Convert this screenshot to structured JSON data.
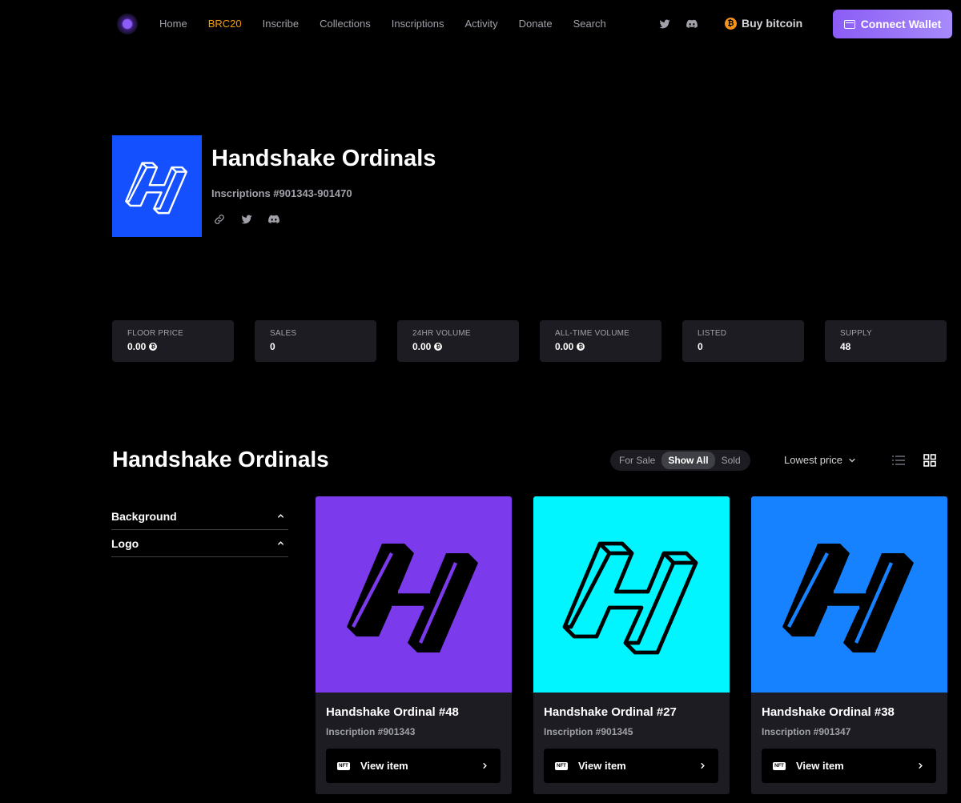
{
  "nav": {
    "links": [
      {
        "label": "Home",
        "active": false
      },
      {
        "label": "BRC20",
        "active": true
      },
      {
        "label": "Inscribe",
        "active": false
      },
      {
        "label": "Collections",
        "active": false
      },
      {
        "label": "Inscriptions",
        "active": false
      },
      {
        "label": "Activity",
        "active": false
      },
      {
        "label": "Donate",
        "active": false
      },
      {
        "label": "Search",
        "active": false
      }
    ],
    "social": [
      "twitter-icon",
      "discord-icon"
    ],
    "buy_bitcoin": "Buy bitcoin",
    "connect_wallet": "Connect Wallet"
  },
  "collection": {
    "title": "Handshake Ordinals",
    "inscriptions": "Inscriptions #901343-901470",
    "links": [
      "link-icon",
      "twitter-icon",
      "discord-icon"
    ]
  },
  "stats": [
    {
      "label": "FLOOR PRICE",
      "value": "0.00",
      "coin": true
    },
    {
      "label": "SALES",
      "value": "0",
      "coin": false
    },
    {
      "label": "24HR VOLUME",
      "value": "0.00",
      "coin": true
    },
    {
      "label": "ALL-TIME VOLUME",
      "value": "0.00",
      "coin": true
    },
    {
      "label": "LISTED",
      "value": "0",
      "coin": false
    },
    {
      "label": "SUPPLY",
      "value": "48",
      "coin": false
    }
  ],
  "section": {
    "title": "Handshake Ordinals",
    "filter_tabs": [
      {
        "label": "For Sale",
        "active": false
      },
      {
        "label": "Show All",
        "active": true
      },
      {
        "label": "Sold",
        "active": false
      }
    ],
    "sort": "Lowest price"
  },
  "filters": [
    "Background",
    "Logo"
  ],
  "items": [
    {
      "name": "Handshake Ordinal #48",
      "inscription": "Inscription #901343",
      "button": "View item",
      "bg": "#7c3aed",
      "style": "solid"
    },
    {
      "name": "Handshake Ordinal #27",
      "inscription": "Inscription #901345",
      "button": "View item",
      "bg": "#00f5ff",
      "style": "outline"
    },
    {
      "name": "Handshake Ordinal #38",
      "inscription": "Inscription #901347",
      "button": "View item",
      "bg": "#1782ff",
      "style": "solid"
    }
  ],
  "colors": {
    "accent": "#8b5cf6",
    "active_nav": "#f59e0b",
    "logo_tile": "#1550ff"
  }
}
